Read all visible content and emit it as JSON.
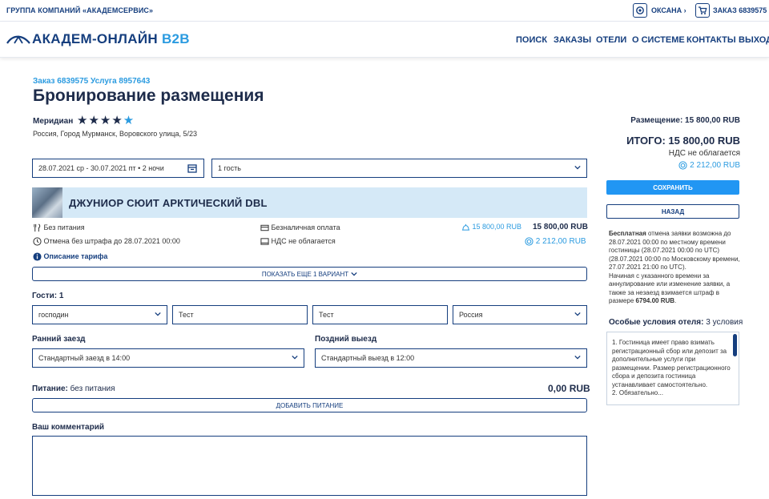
{
  "topbar": {
    "group": "ГРУППА КОМПАНИЙ «АКАДЕМСЕРВИС»",
    "user": "ОКСАНА",
    "order": "ЗАКАЗ 6839575"
  },
  "header": {
    "logo": "АКАДЕМ-ОНЛАЙН",
    "logo_suffix": "B2B",
    "nav": [
      "ПОИСК",
      "ЗАКАЗЫ",
      "ОТЕЛИ",
      "О СИСТЕМЕ",
      "КОНТАКТЫ",
      "ВЫХОД"
    ]
  },
  "page": {
    "order_ref": "Заказ 6839575  Услуга 8957643",
    "title": "Бронирование размещения",
    "hotel_name": "Меридиан",
    "stars": "★★★★",
    "stars_half": "★",
    "address": "Россия, Город Мурманск, Воровского улица, 5/23",
    "dates": "28.07.2021 ср - 30.07.2021 пт • 2 ночи",
    "guests_select": "1 гость"
  },
  "room": {
    "name": "ДЖУНИОР СЮИТ АРКТИЧЕСКИЙ DBL",
    "meal": "Без питания",
    "cancel": "Отмена без штрафа до 28.07.2021 00:00",
    "tariff": "Описание тарифа",
    "payment": "Безналичная оплата",
    "vat": "НДС не облагается",
    "price_net": "15 800,00 RUB",
    "price_total": "15 800,00 RUB",
    "bonus": "2 212,00 RUB",
    "more": "ПОКАЗАТЬ ЕЩЕ 1 ВАРИАНТ"
  },
  "guests": {
    "label": "Гости: 1",
    "title": "господин",
    "first_name": "Тест",
    "last_name": "Тест",
    "country": "Россия"
  },
  "checkin": {
    "early_label": "Ранний заезд",
    "early_value": "Стандартный заезд в 14:00",
    "late_label": "Поздний выезд",
    "late_value": "Стандартный выезд в 12:00"
  },
  "meals": {
    "label": "Питание:",
    "value": "без питания",
    "price": "0,00 RUB",
    "add": "ДОБАВИТЬ ПИТАНИЕ"
  },
  "comment": {
    "label": "Ваш комментарий"
  },
  "summary": {
    "accommodation": "Размещение: 15 800,00 RUB",
    "total": "ИТОГО: 15 800,00 RUB",
    "vat": "НДС не облагается",
    "bonus": "2 212,00 RUB",
    "save": "СОХРАНИТЬ",
    "back": "НАЗАД",
    "cancel_bold": "Бесплатная",
    "cancel_text": " отмена заявки возможна до 28.07.2021 00:00 по местному времени гостиницы (28.07.2021 00:00 по UTC) (28.07.2021 00:00 по Московскому времени, 27.07.2021 21:00 по UTC).",
    "penalty_text": "Начиная с указанного времени за аннулирование или изменение заявки, а также за незаезд взимается штраф в размере ",
    "penalty_amount": "6794.00 RUB",
    "conditions_label": "Особые условия отеля:",
    "conditions_count": "3 условия",
    "conditions_text": "1. Гостиница имеет право взимать регистрационный сбор или депозит за дополнительные услуги при размещении. Размер регистрационного сбора и депозита гостиница устанавливает самостоятельно.",
    "conditions_more": "2. Обязательно..."
  },
  "colors": {
    "navy": "#153e7e",
    "accent": "#2b9be0",
    "save_button": "#2196f3",
    "room_band": "#d5e9f7"
  }
}
